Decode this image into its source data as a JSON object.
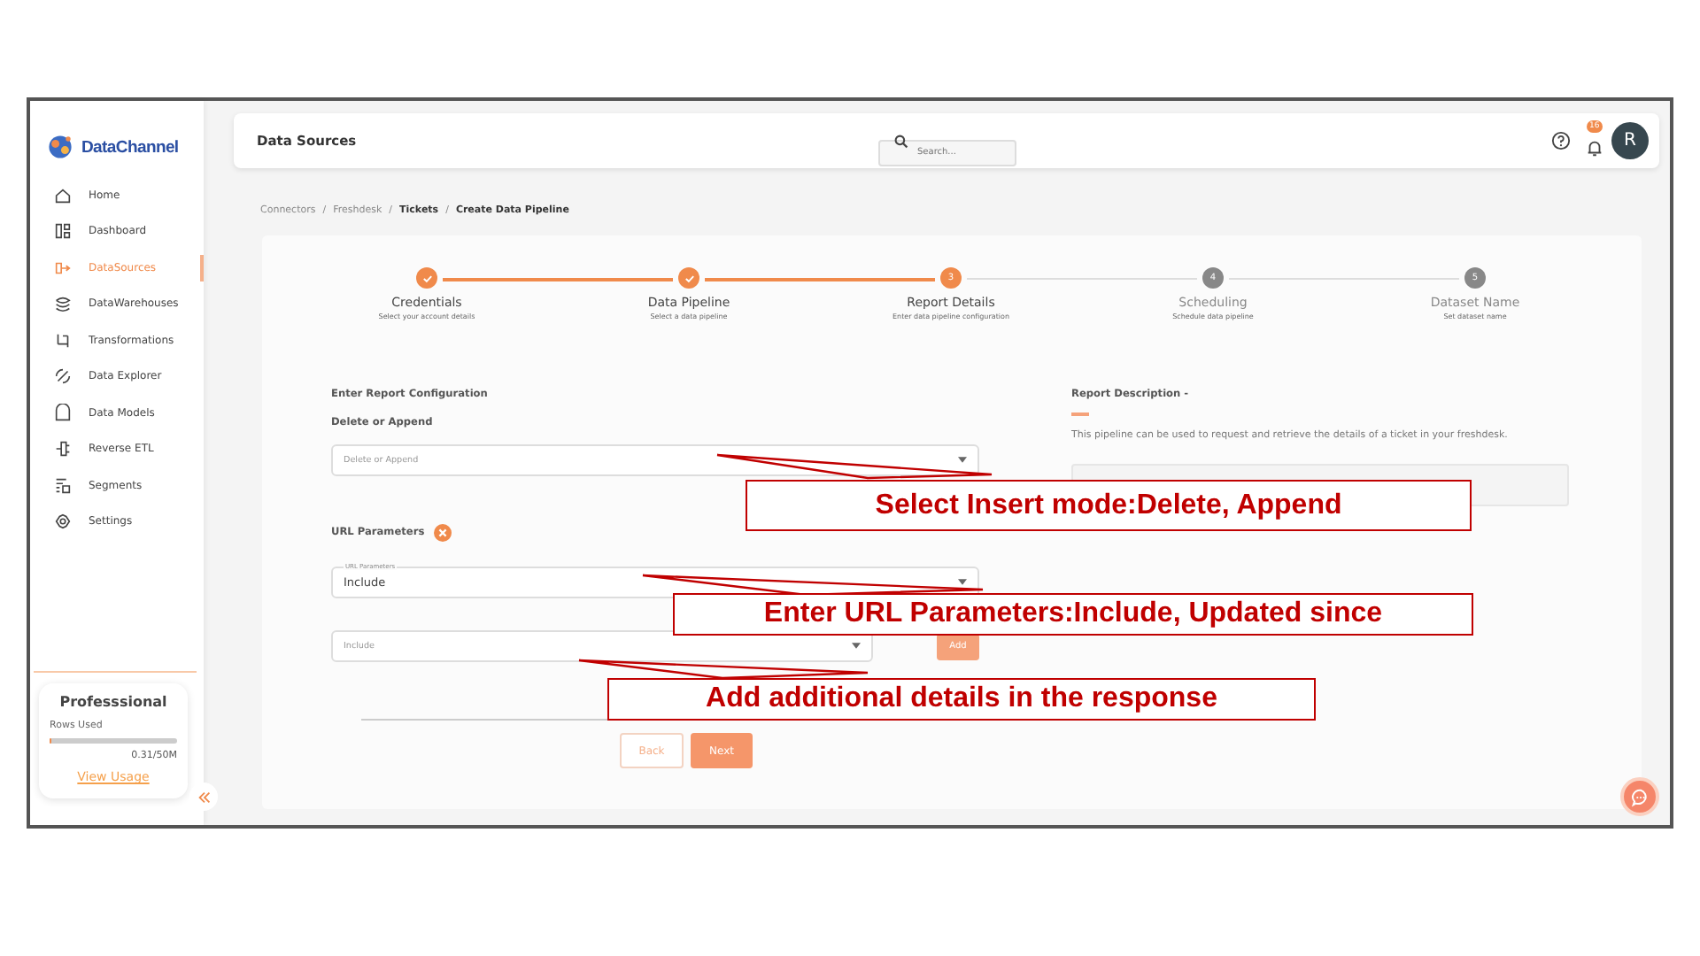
{
  "sidebar": {
    "logo": "DataChannel",
    "items": [
      {
        "label": "Home",
        "selected": false
      },
      {
        "label": "Dashboard",
        "selected": false
      },
      {
        "label": "DataSources",
        "selected": true
      },
      {
        "label": "DataWarehouses",
        "selected": false
      },
      {
        "label": "Transformations",
        "selected": false
      },
      {
        "label": "Data Explorer",
        "selected": false
      },
      {
        "label": "Data Models",
        "selected": false
      },
      {
        "label": "Reverse ETL",
        "selected": false
      },
      {
        "label": "Segments",
        "selected": false
      },
      {
        "label": "Settings",
        "selected": false
      }
    ],
    "plan": {
      "title": "Professsional",
      "usage_label": "Rows Used",
      "level": 0.01,
      "reading": "0.31/50M",
      "link": "View Usage"
    }
  },
  "header": {
    "title": "Data Sources",
    "search": {
      "placeholder": "Search..."
    },
    "notification_count": "16",
    "avatar": "R"
  },
  "breadcrumb": [
    {
      "label": "Connectors",
      "current": false
    },
    {
      "separator": "/",
      "label": "Freshdesk",
      "current": false
    },
    {
      "separator": "/",
      "label": "Tickets",
      "current": true
    },
    {
      "separator": "/",
      "label": "Create Data Pipeline",
      "current": true
    }
  ],
  "steps": [
    {
      "title": "Credentials",
      "subtitle": "Select your account details",
      "kind": "done"
    },
    {
      "title": "Data Pipeline",
      "subtitle": "Select a data pipeline",
      "kind": "done"
    },
    {
      "number": "3",
      "title": "Report Details",
      "subtitle": "Enter data pipeline configuration",
      "kind": "current"
    },
    {
      "number": "4",
      "title": "Scheduling",
      "subtitle": "Schedule data pipeline",
      "kind": "upcoming"
    },
    {
      "number": "5",
      "title": "Dataset Name",
      "subtitle": "Set dataset name",
      "kind": "upcoming"
    }
  ],
  "form": {
    "section_title": "Enter Report Configuration",
    "mode_label": "Delete or Append",
    "mode_select": {
      "placeholder": "Delete or Append"
    },
    "params_label": "URL Parameters",
    "params_select": {
      "label": "URL Parameters",
      "value": "Include"
    },
    "include_select": {
      "placeholder": "Include"
    },
    "add_button": "Add"
  },
  "description": {
    "title": "Report Description -",
    "text": "This pipeline can be used to request and retrieve the details of a ticket in your freshdesk."
  },
  "buttons": {
    "back": "Back",
    "next": "Next"
  },
  "annotations": [
    {
      "text": "Select Insert mode:Delete, Append"
    },
    {
      "text": "Enter URL Parameters:Include, Updated since"
    },
    {
      "text": "Add additional details in the response"
    }
  ]
}
